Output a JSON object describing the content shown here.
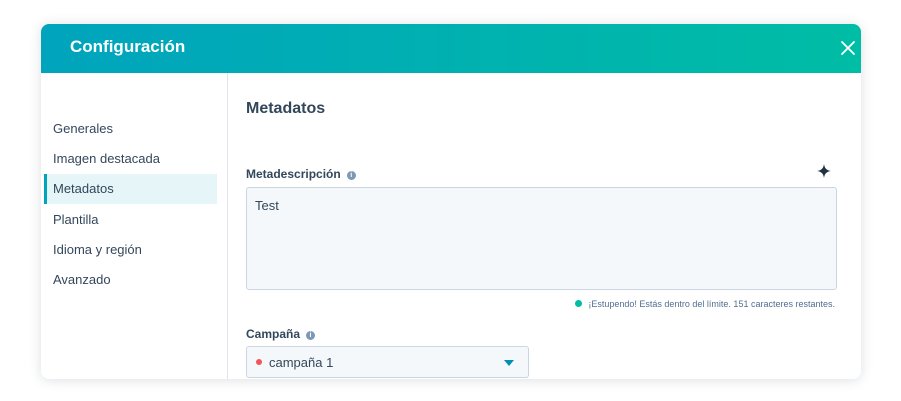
{
  "modal": {
    "title": "Configuración"
  },
  "sidebar": {
    "items": [
      {
        "label": "Generales",
        "active": false
      },
      {
        "label": "Imagen destacada",
        "active": false
      },
      {
        "label": "Metadatos",
        "active": true
      },
      {
        "label": "Plantilla",
        "active": false
      },
      {
        "label": "Idioma y región",
        "active": false
      },
      {
        "label": "Avanzado",
        "active": false
      }
    ]
  },
  "main": {
    "section_title": "Metadatos",
    "meta_description": {
      "label": "Metadescripción",
      "info_icon": "i",
      "value": "Test",
      "status": "¡Estupendo! Estás dentro del límite. 151 caracteres restantes."
    },
    "campaign": {
      "label": "Campaña",
      "info_icon": "i",
      "selected": "campaña 1"
    }
  },
  "colors": {
    "header_gradient_start": "#00a4bd",
    "header_gradient_end": "#00bda5",
    "active_border": "#00a4bd",
    "status_dot": "#00bda5",
    "campaign_dot": "#f2545b"
  }
}
